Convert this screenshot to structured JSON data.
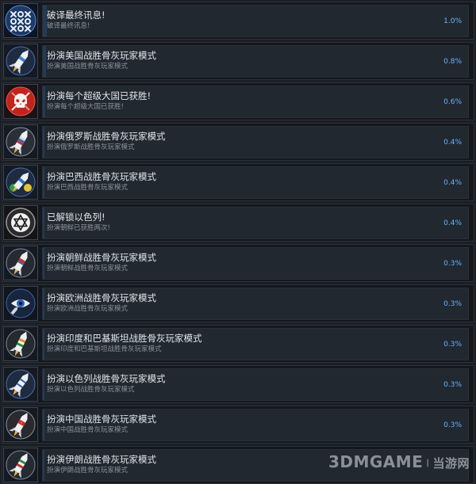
{
  "achievements": [
    {
      "title": "破译最终讯息!",
      "description": "破译最终讯息!",
      "percent": "1.0%",
      "progress": 0.01,
      "icon": "encoded-symbols-icon"
    },
    {
      "title": "扮演美国战胜骨灰玩家模式",
      "description": "扮演美国战胜骨灰玩家模式",
      "percent": "0.8%",
      "progress": 0.008,
      "icon": "missile-icon"
    },
    {
      "title": "扮演每个超级大国已获胜!",
      "description": "扮演每个超级大国已获胜!",
      "percent": "0.6%",
      "progress": 0.006,
      "icon": "skull-icon"
    },
    {
      "title": "扮演俄罗斯战胜骨灰玩家模式",
      "description": "扮演俄罗斯战胜骨灰玩家模式",
      "percent": "0.4%",
      "progress": 0.004,
      "icon": "missile-icon"
    },
    {
      "title": "扮演巴西战胜骨灰玩家模式",
      "description": "扮演巴西战胜骨灰玩家模式",
      "percent": "0.4%",
      "progress": 0.004,
      "icon": "missile-icon"
    },
    {
      "title": "已解锁以色列!",
      "description": "扮演朝鲜已获胜两次!",
      "percent": "0.4%",
      "progress": 0.004,
      "icon": "star-of-david-icon"
    },
    {
      "title": "扮演朝鲜战胜骨灰玩家模式",
      "description": "扮演朝鲜战胜骨灰玩家模式",
      "percent": "0.3%",
      "progress": 0.003,
      "icon": "missile-icon"
    },
    {
      "title": "扮演欧洲战胜骨灰玩家模式",
      "description": "扮演欧洲战胜骨灰玩家模式",
      "percent": "0.3%",
      "progress": 0.003,
      "icon": "eye-missile-icon"
    },
    {
      "title": "扮演印度和巴基斯坦战胜骨灰玩家模式",
      "description": "扮演印度和巴基斯坦战胜骨灰玩家模式",
      "percent": "0.3%",
      "progress": 0.003,
      "icon": "missile-icon"
    },
    {
      "title": "扮演以色列战胜骨灰玩家模式",
      "description": "扮演以色列战胜骨灰玩家模式",
      "percent": "0.3%",
      "progress": 0.003,
      "icon": "missile-icon"
    },
    {
      "title": "扮演中国战胜骨灰玩家模式",
      "description": "扮演中国战胜骨灰玩家模式",
      "percent": "0.3%",
      "progress": 0.003,
      "icon": "missile-icon"
    },
    {
      "title": "扮演伊朗战胜骨灰玩家模式",
      "description": "扮演伊朗战胜骨灰玩家模式",
      "percent": "",
      "progress": 0.003,
      "icon": "missile-icon"
    }
  ],
  "watermark": {
    "brand": "3DMGAME",
    "separator": "|",
    "text": "当游网"
  },
  "colors": {
    "background": "#1b1e24",
    "percent_text": "#66b3ff",
    "progress_fill": "#243b57",
    "skull_badge": "#c0241c"
  }
}
